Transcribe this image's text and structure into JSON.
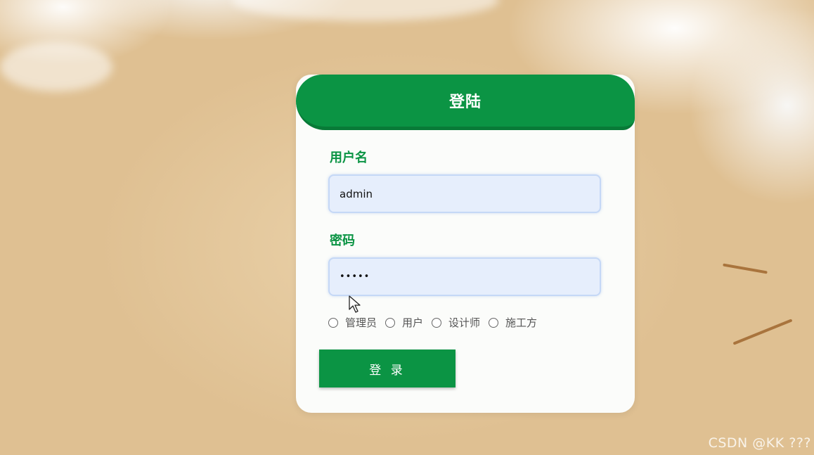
{
  "login": {
    "title": "登陆",
    "username_label": "用户名",
    "username_value": "admin",
    "password_label": "密码",
    "password_value": "•••••",
    "roles": [
      "管理员",
      "用户",
      "设计师",
      "施工方"
    ],
    "submit_label": "登 录"
  },
  "watermark": "CSDN @KK ???",
  "colors": {
    "accent": "#0b9444",
    "accent_dark": "#087a37",
    "input_bg": "#e6eefc",
    "card_bg": "#fbfcfa"
  }
}
